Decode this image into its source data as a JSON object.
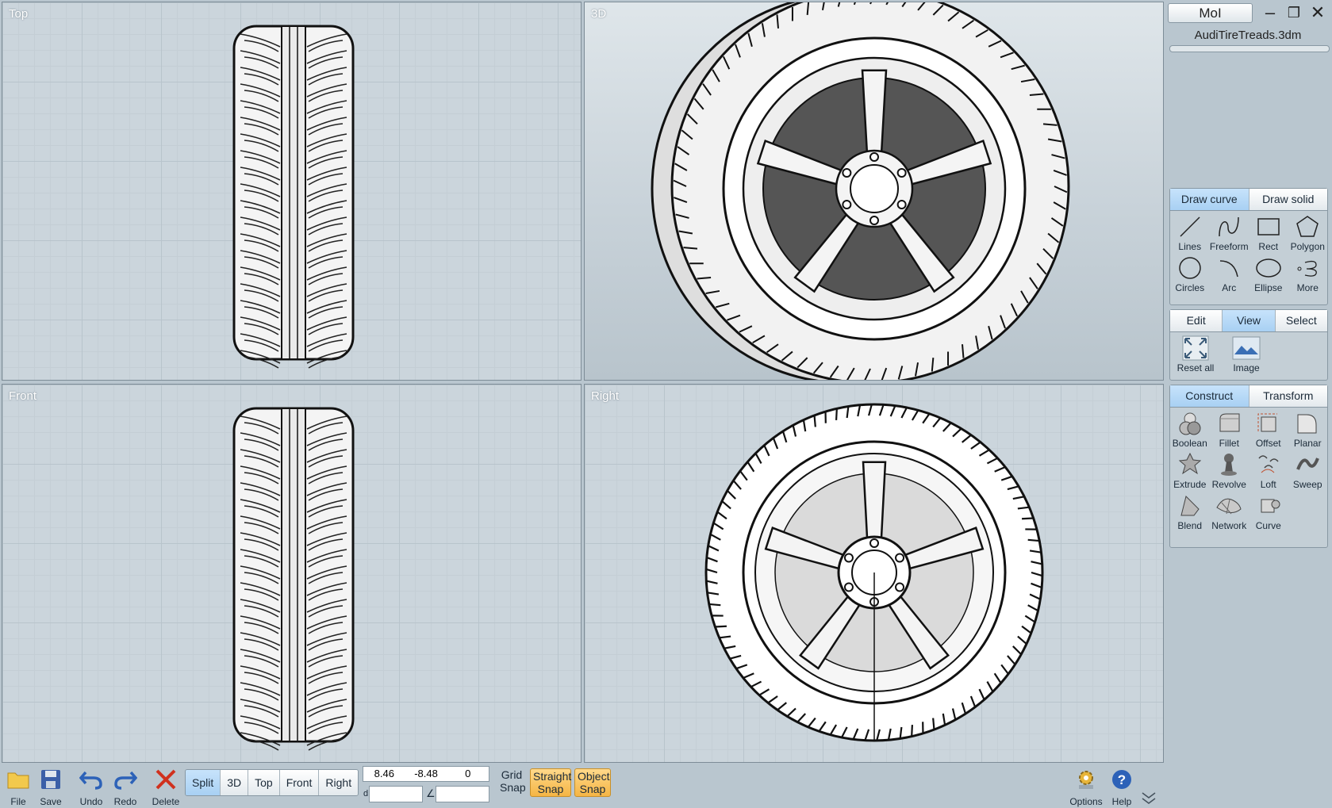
{
  "app": {
    "title": "MoI",
    "filename": "AudiTireTreads.3dm"
  },
  "viewports": [
    {
      "id": "top",
      "label": "Top"
    },
    {
      "id": "3d",
      "label": "3D"
    },
    {
      "id": "front",
      "label": "Front"
    },
    {
      "id": "right",
      "label": "Right"
    }
  ],
  "draw_panel": {
    "tabs": [
      "Draw curve",
      "Draw solid"
    ],
    "active_tab": "Draw curve",
    "tools": [
      {
        "label": "Lines",
        "icon": "line-icon"
      },
      {
        "label": "Freeform",
        "icon": "freeform-icon"
      },
      {
        "label": "Rect",
        "icon": "rect-icon"
      },
      {
        "label": "Polygon",
        "icon": "polygon-icon"
      },
      {
        "label": "Circles",
        "icon": "circle-icon"
      },
      {
        "label": "Arc",
        "icon": "arc-icon"
      },
      {
        "label": "Ellipse",
        "icon": "ellipse-icon"
      },
      {
        "label": "More",
        "icon": "more-icon"
      }
    ]
  },
  "view_panel": {
    "tabs": [
      "Edit",
      "View",
      "Select"
    ],
    "active_tab": "View",
    "tools": [
      {
        "label": "Reset all",
        "icon": "reset-all-icon"
      },
      {
        "label": "Image",
        "icon": "image-icon"
      }
    ]
  },
  "construct_panel": {
    "tabs": [
      "Construct",
      "Transform"
    ],
    "active_tab": "Construct",
    "tools": [
      {
        "label": "Boolean",
        "icon": "boolean-icon"
      },
      {
        "label": "Fillet",
        "icon": "fillet-icon"
      },
      {
        "label": "Offset",
        "icon": "offset-icon"
      },
      {
        "label": "Planar",
        "icon": "planar-icon"
      },
      {
        "label": "Extrude",
        "icon": "extrude-icon"
      },
      {
        "label": "Revolve",
        "icon": "revolve-icon"
      },
      {
        "label": "Loft",
        "icon": "loft-icon"
      },
      {
        "label": "Sweep",
        "icon": "sweep-icon"
      },
      {
        "label": "Blend",
        "icon": "blend-icon"
      },
      {
        "label": "Network",
        "icon": "network-icon"
      },
      {
        "label": "Curve",
        "icon": "curve-icon"
      }
    ]
  },
  "toolbar": {
    "file": "File",
    "save": "Save",
    "undo": "Undo",
    "redo": "Redo",
    "delete": "Delete",
    "views": [
      "Split",
      "3D",
      "Top",
      "Front",
      "Right"
    ],
    "active_view": "Split",
    "coords": [
      "8.46",
      "-8.48",
      "0"
    ],
    "distance_label": "d",
    "angle_label": "∠",
    "grid_snap": "Grid Snap",
    "straight_snap": "Straight Snap",
    "object_snap": "Object Snap",
    "options": "Options",
    "help": "Help"
  },
  "colors": {
    "active_tab": "#b4d8f7",
    "snap_on": "#f5b545",
    "viewport_bg": "#cbd5dc"
  }
}
